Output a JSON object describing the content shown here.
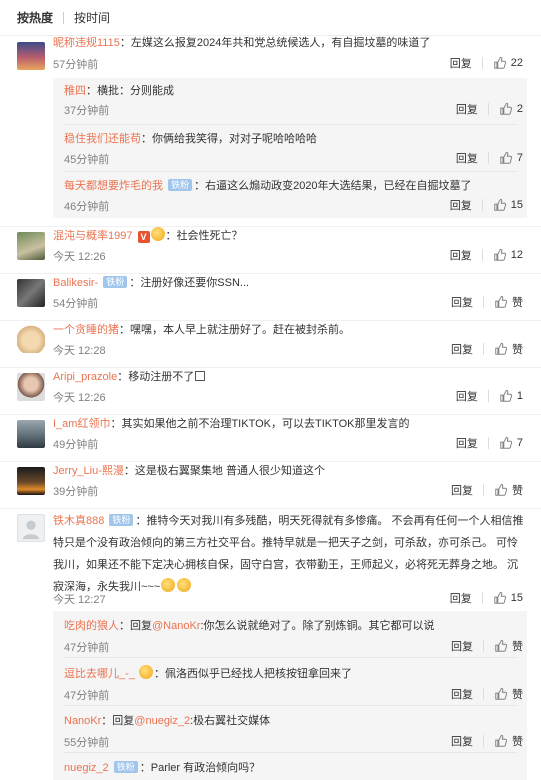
{
  "sort": {
    "hot": "按热度",
    "time": "按时间"
  },
  "reply_label": "回复",
  "like_label": "赞",
  "c1": {
    "user": "昵称违规1115",
    "sep": "：",
    "text": "左媒这么报复2024年共和党总统候选人，有自掘坟墓的味道了",
    "time": "57分钟前",
    "likes": "22",
    "replies": [
      {
        "user": "稚四",
        "sep": "：",
        "text": "横批：分则能成",
        "time": "37分钟前",
        "likes": "2"
      },
      {
        "user": "稳住我们还能苟",
        "sep": "：",
        "text": "你俩给我笑得，对对子呢哈哈哈哈",
        "time": "45分钟前",
        "likes": "7"
      },
      {
        "user": "每天都想要炸毛的我",
        "badge": "铁粉",
        "sep": "：",
        "text": "右逼这么煽动政变2020年大选结果，已经在自掘坟墓了",
        "time": "46分钟前",
        "likes": "15"
      }
    ]
  },
  "c2": {
    "user": "混沌与概率1997",
    "v": "V",
    "sep": "：",
    "text": "社会性死亡？",
    "time": "今天 12:26",
    "likes": "12"
  },
  "c3": {
    "user": "Balikesir-",
    "badge": "铁粉",
    "sep": "：",
    "text": "注册好像还要你SSN...",
    "time": "54分钟前"
  },
  "c4": {
    "user": "一个贪睡的猪",
    "sep": "：",
    "text": "嘿嘿，本人早上就注册好了。赶在被封杀前。",
    "time": "今天 12:28"
  },
  "c5": {
    "user": "Aripi_prazole",
    "sep": "：",
    "text": "移动注册不了",
    "time": "今天 12:26",
    "likes": "1"
  },
  "c6": {
    "user": "I_am红领巾",
    "sep": "：",
    "text": "其实如果他之前不治理TIKTOK，可以去TIKTOK那里发言的",
    "time": "49分钟前",
    "likes": "7"
  },
  "c7": {
    "user": "Jerry_Liu-熙漫",
    "sep": "：",
    "text": "这是极右翼聚集地 普通人很少知道这个",
    "time": "39分钟前"
  },
  "c8": {
    "user": "铁木真888",
    "badge": "铁粉",
    "sep": "：",
    "text": "推特今天对我川有多残酷，明天死得就有多惨痛。 不会再有任何一个人相信推特只是个没有政治倾向的第三方社交平台。推特早就是一把天子之剑，可杀敌，亦可杀己。 可怜我川，如果还不能下定决心拥核自保，固守白宫，衣带勤王，王师起义，必将死无葬身之地。 沉寂深海，永失我川~~~",
    "time": "今天 12:27",
    "likes": "15",
    "replies": [
      {
        "user": "吃肉的狼人",
        "sep": "：",
        "pre": "回复",
        "mention": "@NanoKr",
        "text": ":你怎么说就绝对了。除了别炼铜。其它都可以说",
        "time": "47分钟前"
      },
      {
        "user": "逗比去哪儿_-_",
        "sep": "：",
        "text": "佩洛西似乎已经找人把核按钮拿回来了",
        "time": "47分钟前"
      },
      {
        "user": "NanoKr",
        "sep": "：",
        "pre": "回复",
        "mention": "@nuegiz_2",
        "text": ":极右翼社交媒体",
        "time": "55分钟前"
      },
      {
        "user": "nuegiz_2",
        "badge": "铁粉",
        "sep": "：",
        "text": "Parler 有政治倾向吗？"
      }
    ]
  }
}
